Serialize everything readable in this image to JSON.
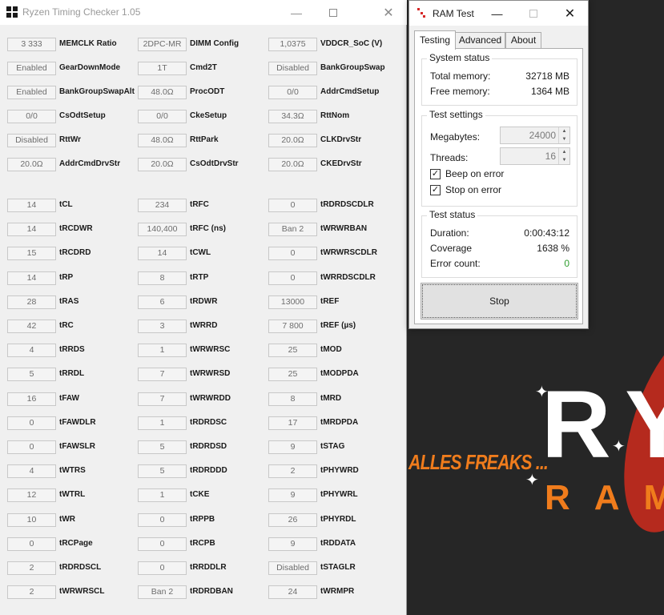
{
  "background": {
    "slogan": "ALLES FREAKS ...",
    "logo_text": "RY",
    "logo_subtext": "RAM C"
  },
  "rtc": {
    "title": "Ryzen Timing Checker 1.05",
    "top_rows": [
      [
        {
          "value": "3 333",
          "label": "MEMCLK Ratio"
        },
        {
          "value": "2DPC-MR",
          "label": "DIMM Config"
        },
        {
          "value": "1,0375",
          "label": "VDDCR_SoC (V)"
        }
      ],
      [
        {
          "value": "Enabled",
          "label": "GearDownMode"
        },
        {
          "value": "1T",
          "label": "Cmd2T"
        },
        {
          "value": "Disabled",
          "label": "BankGroupSwap"
        }
      ],
      [
        {
          "value": "Enabled",
          "label": "BankGroupSwapAlt"
        },
        {
          "value": "48.0Ω",
          "label": "ProcODT"
        },
        {
          "value": "0/0",
          "label": "AddrCmdSetup"
        }
      ],
      [
        {
          "value": "0/0",
          "label": "CsOdtSetup"
        },
        {
          "value": "0/0",
          "label": "CkeSetup"
        },
        {
          "value": "34.3Ω",
          "label": "RttNom"
        }
      ],
      [
        {
          "value": "Disabled",
          "label": "RttWr"
        },
        {
          "value": "48.0Ω",
          "label": "RttPark"
        },
        {
          "value": "20.0Ω",
          "label": "CLKDrvStr"
        }
      ],
      [
        {
          "value": "20.0Ω",
          "label": "AddrCmdDrvStr"
        },
        {
          "value": "20.0Ω",
          "label": "CsOdtDrvStr"
        },
        {
          "value": "20.0Ω",
          "label": "CKEDrvStr"
        }
      ]
    ],
    "timing_rows": [
      [
        {
          "value": "14",
          "label": "tCL"
        },
        {
          "value": "234",
          "label": "tRFC"
        },
        {
          "value": "0",
          "label": "tRDRDSCDLR"
        }
      ],
      [
        {
          "value": "14",
          "label": "tRCDWR"
        },
        {
          "value": "140,400",
          "label": "tRFC (ns)"
        },
        {
          "value": "Ban 2",
          "label": "tWRWRBAN"
        }
      ],
      [
        {
          "value": "15",
          "label": "tRCDRD"
        },
        {
          "value": "14",
          "label": "tCWL"
        },
        {
          "value": "0",
          "label": "tWRWRSCDLR"
        }
      ],
      [
        {
          "value": "14",
          "label": "tRP"
        },
        {
          "value": "8",
          "label": "tRTP"
        },
        {
          "value": "0",
          "label": "tWRRDSCDLR"
        }
      ],
      [
        {
          "value": "28",
          "label": "tRAS"
        },
        {
          "value": "6",
          "label": "tRDWR"
        },
        {
          "value": "13000",
          "label": "tREF"
        }
      ],
      [
        {
          "value": "42",
          "label": "tRC"
        },
        {
          "value": "3",
          "label": "tWRRD"
        },
        {
          "value": "7 800",
          "label": "tREF (µs)"
        }
      ],
      [
        {
          "value": "4",
          "label": "tRRDS"
        },
        {
          "value": "1",
          "label": "tWRWRSC"
        },
        {
          "value": "25",
          "label": "tMOD"
        }
      ],
      [
        {
          "value": "5",
          "label": "tRRDL"
        },
        {
          "value": "7",
          "label": "tWRWRSD"
        },
        {
          "value": "25",
          "label": "tMODPDA"
        }
      ],
      [
        {
          "value": "16",
          "label": "tFAW"
        },
        {
          "value": "7",
          "label": "tWRWRDD"
        },
        {
          "value": "8",
          "label": "tMRD"
        }
      ],
      [
        {
          "value": "0",
          "label": "tFAWDLR"
        },
        {
          "value": "1",
          "label": "tRDRDSC"
        },
        {
          "value": "17",
          "label": "tMRDPDA"
        }
      ],
      [
        {
          "value": "0",
          "label": "tFAWSLR"
        },
        {
          "value": "5",
          "label": "tRDRDSD"
        },
        {
          "value": "9",
          "label": "tSTAG"
        }
      ],
      [
        {
          "value": "4",
          "label": "tWTRS"
        },
        {
          "value": "5",
          "label": "tRDRDDD"
        },
        {
          "value": "2",
          "label": "tPHYWRD"
        }
      ],
      [
        {
          "value": "12",
          "label": "tWTRL"
        },
        {
          "value": "1",
          "label": "tCKE"
        },
        {
          "value": "9",
          "label": "tPHYWRL"
        }
      ],
      [
        {
          "value": "10",
          "label": "tWR"
        },
        {
          "value": "0",
          "label": "tRPPB"
        },
        {
          "value": "26",
          "label": "tPHYRDL"
        }
      ],
      [
        {
          "value": "0",
          "label": "tRCPage"
        },
        {
          "value": "0",
          "label": "tRCPB"
        },
        {
          "value": "9",
          "label": "tRDDATA"
        }
      ],
      [
        {
          "value": "2",
          "label": "tRDRDSCL"
        },
        {
          "value": "0",
          "label": "tRRDDLR"
        },
        {
          "value": "Disabled",
          "label": "tSTAGLR"
        }
      ],
      [
        {
          "value": "2",
          "label": "tWRWRSCL"
        },
        {
          "value": "Ban 2",
          "label": "tRDRDBAN"
        },
        {
          "value": "24",
          "label": "tWRMPR"
        }
      ]
    ]
  },
  "ramtest": {
    "title": "RAM Test",
    "tabs": [
      {
        "label": "Testing",
        "active": true
      },
      {
        "label": "Advanced",
        "active": false
      },
      {
        "label": "About",
        "active": false
      }
    ],
    "system_status": {
      "title": "System status",
      "total_memory_label": "Total memory:",
      "total_memory_value": "32718 MB",
      "free_memory_label": "Free memory:",
      "free_memory_value": "1364 MB"
    },
    "test_settings": {
      "title": "Test settings",
      "megabytes_label": "Megabytes:",
      "megabytes_value": "24000",
      "threads_label": "Threads:",
      "threads_value": "16",
      "beep_label": "Beep on error",
      "beep_checked": true,
      "stop_label": "Stop on error",
      "stop_checked": true
    },
    "test_status": {
      "title": "Test status",
      "duration_label": "Duration:",
      "duration_value": "0:00:43:12",
      "coverage_label": "Coverage",
      "coverage_value": "1638 %",
      "error_label": "Error count:",
      "error_value": "0",
      "error_color": "#2e9e2e"
    },
    "stop_button": "Stop"
  }
}
